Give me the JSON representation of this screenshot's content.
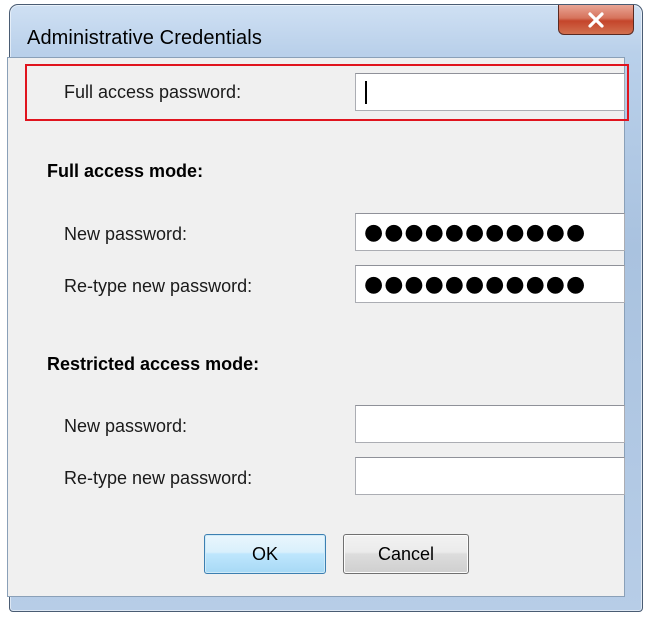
{
  "window": {
    "title": "Administrative Credentials"
  },
  "full_access_password": {
    "label": "Full access password:",
    "value": ""
  },
  "full_access_mode": {
    "heading": "Full access mode:",
    "new_password_label": "New password:",
    "new_password_value": "●●●●●●●●●●●",
    "retype_label": "Re-type new password:",
    "retype_value": "●●●●●●●●●●●"
  },
  "restricted_access_mode": {
    "heading": "Restricted access mode:",
    "new_password_label": "New password:",
    "new_password_value": "",
    "retype_label": "Re-type new password:",
    "retype_value": ""
  },
  "buttons": {
    "ok_label": "OK",
    "cancel_label": "Cancel"
  },
  "colors": {
    "highlight": "#e0141e",
    "close_button": "#c4452b",
    "dialog_background": "#f0f0f0"
  },
  "icons": {
    "close": "close-icon"
  }
}
